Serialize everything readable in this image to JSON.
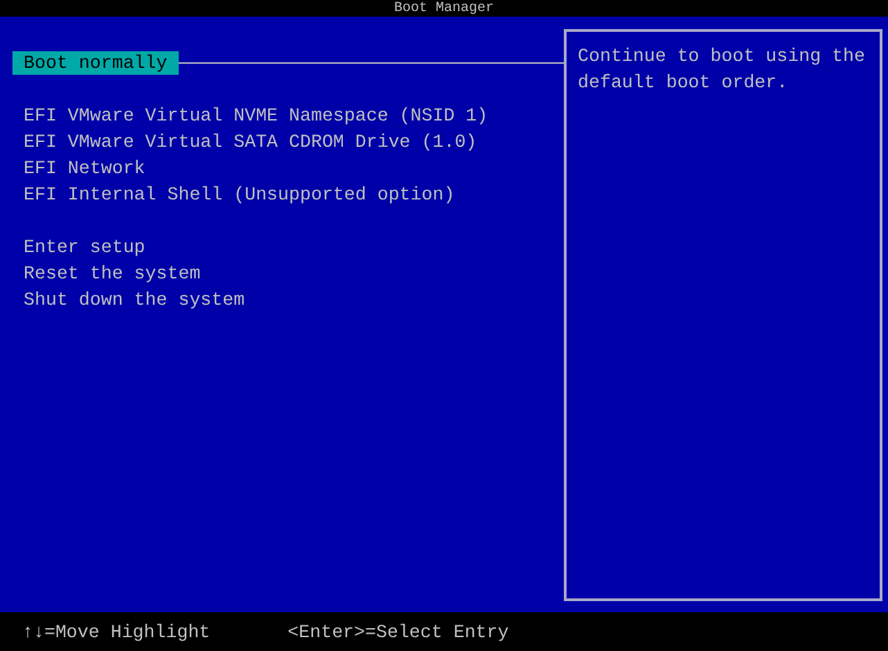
{
  "window": {
    "title": "Boot Manager"
  },
  "menu": {
    "groups": [
      [
        {
          "label": "Boot normally",
          "selected": true
        }
      ],
      [
        {
          "label": "EFI VMware Virtual NVME Namespace (NSID 1)",
          "selected": false
        },
        {
          "label": "EFI VMware Virtual SATA CDROM Drive (1.0)",
          "selected": false
        },
        {
          "label": "EFI Network",
          "selected": false
        },
        {
          "label": "EFI Internal Shell (Unsupported option)",
          "selected": false
        }
      ],
      [
        {
          "label": "Enter setup",
          "selected": false
        },
        {
          "label": "Reset the system",
          "selected": false
        },
        {
          "label": "Shut down the system",
          "selected": false
        }
      ]
    ]
  },
  "help": {
    "text": "Continue to boot using the default boot order."
  },
  "status_bar": [
    {
      "keys": "↑↓",
      "action": "=Move Highlight"
    },
    {
      "keys": "<Enter>",
      "action": "=Select Entry"
    }
  ]
}
